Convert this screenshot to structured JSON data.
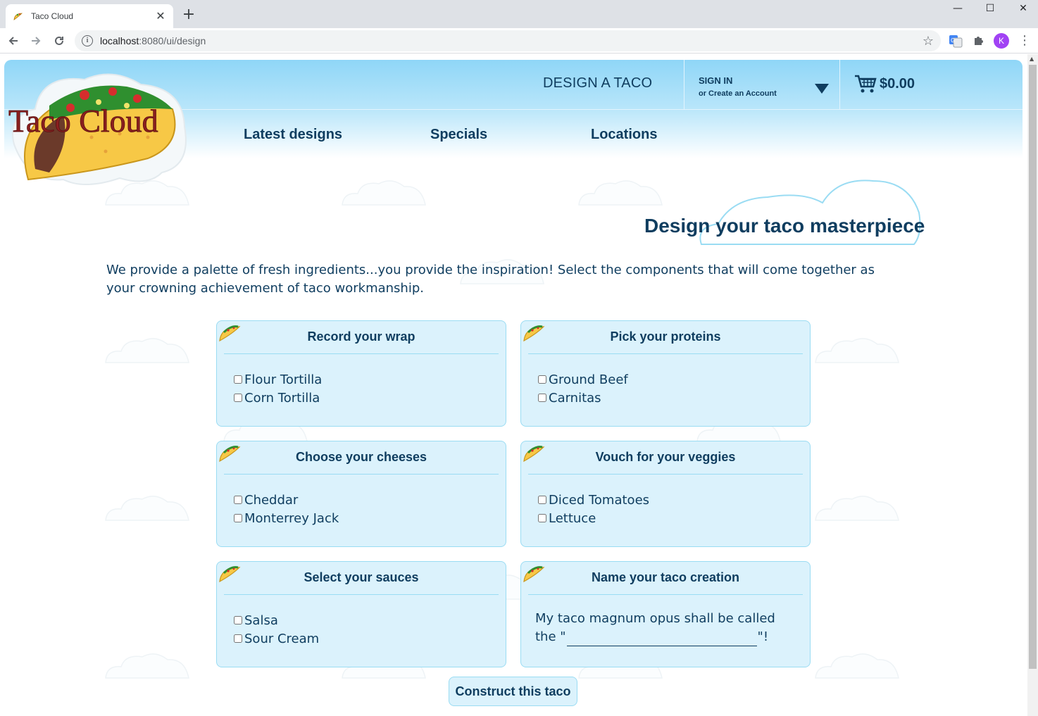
{
  "browser": {
    "tab_title": "Taco Cloud",
    "close_symbol": "✕",
    "new_tab_symbol": "+",
    "url_host": "localhost",
    "url_path": ":8080/ui/design",
    "profile_initial": "K",
    "info_symbol": "i",
    "minimize_symbol": "—",
    "maximize_symbol": "☐",
    "window_close_symbol": "✕"
  },
  "header": {
    "logo_text": "Taco Cloud",
    "design_link": "DESIGN A TACO",
    "signin_label": "SIGN IN",
    "signin_sub": "or Create an Account",
    "cart_total": "$0.00",
    "nav": [
      "Latest designs",
      "Specials",
      "Locations"
    ]
  },
  "main": {
    "title": "Design your taco masterpiece",
    "intro": "We provide a palette of fresh ingredients...you provide the inspiration! Select the components that will come together as your crowning achievement of taco workmanship."
  },
  "groups": [
    {
      "title": "Record your wrap",
      "options": [
        "Flour Tortilla",
        "Corn Tortilla"
      ]
    },
    {
      "title": "Pick your proteins",
      "options": [
        "Ground Beef",
        "Carnitas"
      ]
    },
    {
      "title": "Choose your cheeses",
      "options": [
        "Cheddar",
        "Monterrey Jack"
      ]
    },
    {
      "title": "Vouch for your veggies",
      "options": [
        "Diced Tomatoes",
        "Lettuce"
      ]
    },
    {
      "title": "Select your sauces",
      "options": [
        "Salsa",
        "Sour Cream"
      ]
    }
  ],
  "name_card": {
    "title": "Name your taco creation",
    "prefix": "My taco magnum opus shall be called the \"",
    "suffix": "\"!",
    "value": ""
  },
  "submit_label": "Construct this taco",
  "colors": {
    "brand_text": "#0f3d5f",
    "card_bg": "#dbf2fc",
    "card_border": "#9adcf3",
    "header_sky": "#8fd6f7"
  }
}
